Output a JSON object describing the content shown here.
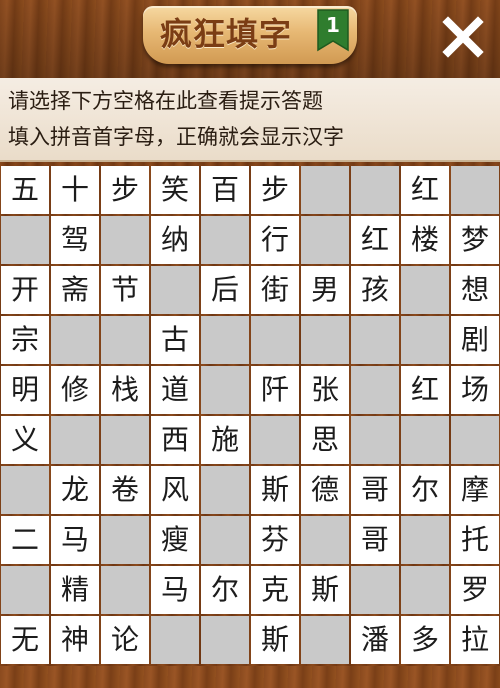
{
  "header": {
    "title": "疯狂填字",
    "level": "1",
    "close_icon": "close-icon",
    "colors": {
      "plaque": "#e7b874",
      "title": "#7b3d14",
      "badge": "#2f7d2e"
    }
  },
  "hint": {
    "line1": "请选择下方空格在此查看提示答题",
    "line2": "填入拼音首字母，正确就会显示汉字"
  },
  "board": {
    "rows": 10,
    "cols": 10,
    "colors": {
      "blank": "#c9c9c9",
      "filled": "#ffffff",
      "grid": "#8b4a1d"
    },
    "grid": [
      [
        "五",
        "十",
        "步",
        "笑",
        "百",
        "步",
        "#",
        "#",
        "红",
        "#"
      ],
      [
        "#",
        "驾",
        "#",
        "纳",
        "#",
        "行",
        "#",
        "红",
        "楼",
        "梦"
      ],
      [
        "开",
        "斋",
        "节",
        "#",
        "后",
        "街",
        "男",
        "孩",
        "#",
        "想"
      ],
      [
        "宗",
        "#",
        "#",
        "古",
        "#",
        "#",
        "#",
        "#",
        "#",
        "剧"
      ],
      [
        "明",
        "修",
        "栈",
        "道",
        "#",
        "阡",
        "张",
        "#",
        "红",
        "场"
      ],
      [
        "义",
        "#",
        "#",
        "西",
        "施",
        "#",
        "思",
        "#",
        "#",
        "#"
      ],
      [
        "#",
        "龙",
        "卷",
        "风",
        "#",
        "斯",
        "德",
        "哥",
        "尔",
        "摩"
      ],
      [
        "二",
        "马",
        "#",
        "瘦",
        "#",
        "芬",
        "#",
        "哥",
        "#",
        "托"
      ],
      [
        "#",
        "精",
        "#",
        "马",
        "尔",
        "克",
        "斯",
        "#",
        "#",
        "罗"
      ],
      [
        "无",
        "神",
        "论",
        "#",
        "#",
        "斯",
        "#",
        "潘",
        "多",
        "拉"
      ]
    ]
  }
}
